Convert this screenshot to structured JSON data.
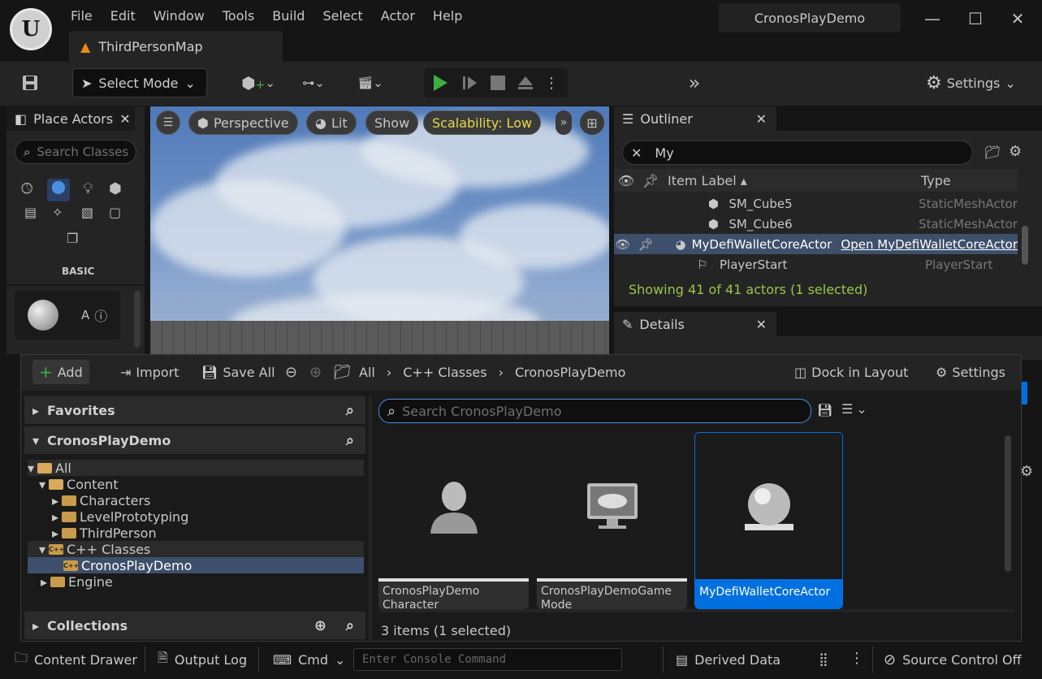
{
  "menu": {
    "items": [
      "File",
      "Edit",
      "Window",
      "Tools",
      "Build",
      "Select",
      "Actor",
      "Help"
    ]
  },
  "project_name": "CronosPlayDemo",
  "level_tab": "ThirdPersonMap",
  "toolbar": {
    "select_mode": "Select Mode",
    "settings": "Settings"
  },
  "place_actors": {
    "title": "Place Actors",
    "search_placeholder": "Search Classes",
    "category": "BASIC",
    "item_initial": "A"
  },
  "viewport": {
    "perspective": "Perspective",
    "lit": "Lit",
    "show": "Show",
    "scalability": "Scalability: Low"
  },
  "outliner": {
    "title": "Outliner",
    "search_value": "My",
    "col_label": "Item Label",
    "col_type": "Type",
    "rows": [
      {
        "label": "SM_Cube5",
        "type": "StaticMeshActor"
      },
      {
        "label": "SM_Cube6",
        "type": "StaticMeshActor"
      },
      {
        "label": "MyDefiWalletCoreActor",
        "type": "Open MyDefiWalletCoreActor"
      },
      {
        "label": "PlayerStart",
        "type": "PlayerStart"
      }
    ],
    "status": "Showing 41 of 41 actors (1 selected)"
  },
  "details": {
    "title": "Details"
  },
  "drawer": {
    "add": "Add",
    "import": "Import",
    "save_all": "Save All",
    "path": [
      "All",
      "C++ Classes",
      "CronosPlayDemo"
    ],
    "dock": "Dock in Layout",
    "settings": "Settings",
    "favorites": "Favorites",
    "project": "CronosPlayDemo",
    "collections": "Collections",
    "tree": [
      "All",
      "Content",
      "Characters",
      "LevelPrototyping",
      "ThirdPerson",
      "C++ Classes",
      "CronosPlayDemo",
      "Engine"
    ],
    "search_placeholder": "Search CronosPlayDemo",
    "assets": [
      {
        "name": "CronosPlayDemo Character"
      },
      {
        "name": "CronosPlayDemoGame Mode"
      },
      {
        "name": "MyDefiWalletCoreActor"
      }
    ],
    "count": "3 items (1 selected)"
  },
  "statusbar": {
    "content_drawer": "Content Drawer",
    "output_log": "Output Log",
    "cmd": "Cmd",
    "console_placeholder": "Enter Console Command",
    "derived_data": "Derived Data",
    "source_control": "Source Control Off"
  },
  "colors": {
    "accent_blue": "#0070e0",
    "play_green": "#3cb043",
    "scalability_yellow": "#e8d84a",
    "status_green": "#9ac44b"
  }
}
